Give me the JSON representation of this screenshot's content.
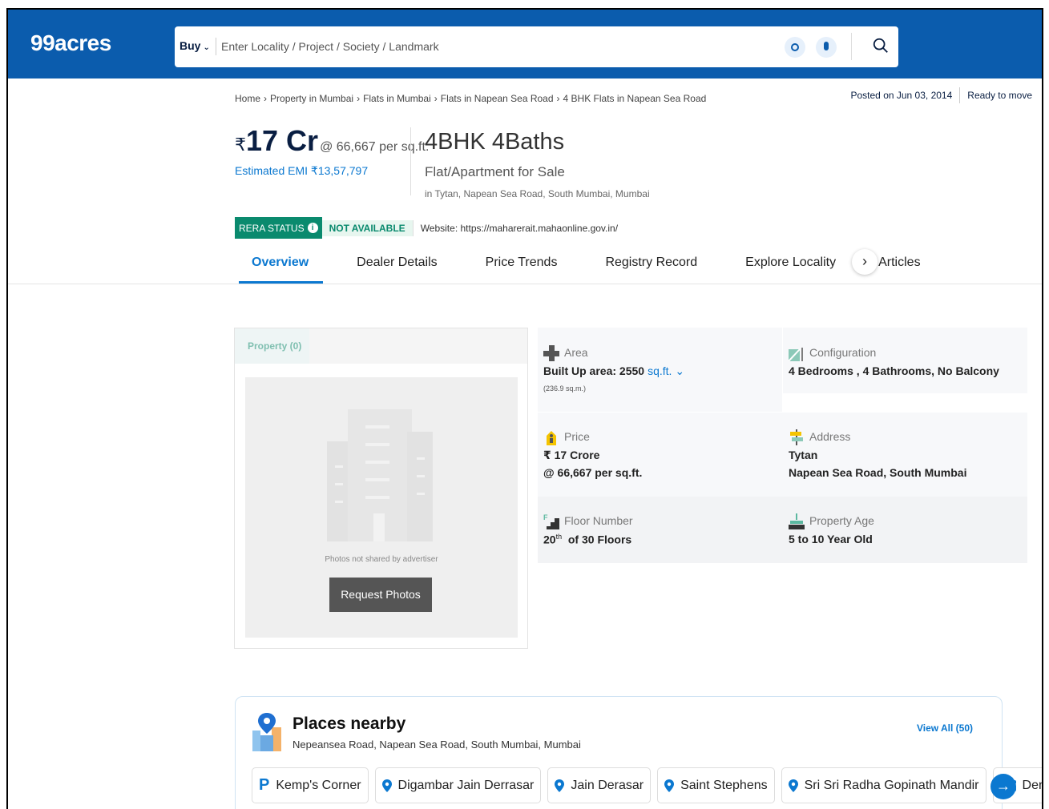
{
  "header": {
    "logo": "99acres",
    "buy_label": "Buy",
    "search_placeholder": "Enter Locality / Project / Society / Landmark",
    "brand_color": "#0B5CAD"
  },
  "breadcrumb": [
    "Home",
    "Property in Mumbai",
    "Flats in Mumbai",
    "Flats in Napean Sea Road",
    "4 BHK Flats in Napean Sea Road"
  ],
  "meta": {
    "posted": "Posted on Jun 03, 2014",
    "status": "Ready to move"
  },
  "listing": {
    "price_symbol": "₹",
    "price": "17 Cr",
    "per_sqft": "@ 66,667 per sq.ft.",
    "emi": "Estimated EMI ₹13,57,797",
    "config": "4BHK 4Baths",
    "type": "Flat/Apartment for Sale",
    "location": "in Tytan, Napean Sea Road, South Mumbai, Mumbai"
  },
  "rera": {
    "label": "RERA STATUS",
    "value": "NOT AVAILABLE",
    "website": "Website: https://maharerait.mahaonline.gov.in/"
  },
  "tabs": [
    "Overview",
    "Dealer Details",
    "Price Trends",
    "Registry Record",
    "Explore Locality",
    "Articles"
  ],
  "photos": {
    "tab": "Property (0)",
    "message": "Photos not shared by advertiser",
    "button": "Request Photos"
  },
  "details": {
    "area": {
      "label": "Area",
      "value": "Built Up area: 2550",
      "unit": "sq.ft.",
      "sub": "(236.9 sq.m.)"
    },
    "configuration": {
      "label": "Configuration",
      "value": "4 Bedrooms , 4 Bathrooms, No Balcony"
    },
    "price": {
      "label": "Price",
      "value": "₹ 17 Crore",
      "sub": "@ 66,667 per sq.ft."
    },
    "address": {
      "label": "Address",
      "value": "Tytan",
      "sub": "Napean Sea Road, South Mumbai"
    },
    "floor": {
      "label": "Floor Number",
      "value": "20",
      "sup": "th",
      "sub": "of 30 Floors"
    },
    "age": {
      "label": "Property Age",
      "value": "5 to 10 Year Old"
    }
  },
  "places": {
    "title": "Places nearby",
    "subtitle": "Nepeansea Road, Napean Sea Road, South Mumbai, Mumbai",
    "view_all": "View All (50)",
    "chips": [
      {
        "icon": "parking-icon",
        "name": "Kemp's Corner"
      },
      {
        "icon": "location-pin-icon",
        "name": "Digambar Jain Derrasar"
      },
      {
        "icon": "location-pin-icon",
        "name": "Jain Derasar"
      },
      {
        "icon": "location-pin-icon",
        "name": "Saint Stephens"
      },
      {
        "icon": "location-pin-icon",
        "name": "Sri Sri Radha Gopinath Mandir"
      },
      {
        "icon": "card-icon",
        "name": "Dena B"
      }
    ]
  }
}
